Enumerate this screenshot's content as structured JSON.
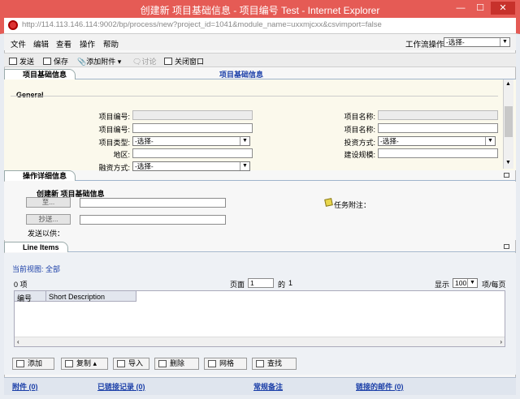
{
  "window": {
    "title": "创建新 项目基础信息 - 项目编号 Test - Internet Explorer",
    "min": "—",
    "max": "☐",
    "close": "✕"
  },
  "address": {
    "url": "http://114.113.146.114:9002/bp/process/new?project_id=1041&module_name=uxxmjcxx&csvimport=false"
  },
  "menu": {
    "items": [
      "文件",
      "编辑",
      "查看",
      "操作",
      "帮助"
    ],
    "workflow_label": "工作流操作",
    "workflow_value": "-选择-"
  },
  "toolbar": {
    "send": "发送",
    "save": "保存",
    "attach": "添加附件",
    "discuss": "讨论",
    "close": "关闭窗口"
  },
  "project": {
    "tab": "项目基础信息",
    "center_title": "项目基础信息",
    "group": "General",
    "labels": {
      "code_ro": "项目编号:",
      "code": "项目编号:",
      "type": "项目类型:",
      "region": "地区:",
      "finance": "融资方式:",
      "name_ro": "项目名称:",
      "name": "项目名称:",
      "invest": "投资方式:",
      "scale": "建设规模:"
    },
    "select_default": "-选择-"
  },
  "detail": {
    "tab": "操作详细信息",
    "title": "创建新 项目基础信息",
    "to_btn": "至...",
    "cc_btn": "抄送...",
    "send_for": "发送以供：",
    "task_note": "任务附注："
  },
  "line_items": {
    "tab": "Line Items",
    "view_label": "当前视图:",
    "view_value": "全部",
    "count": "0 项",
    "page_label": "页面",
    "page_value": "1",
    "of_label": "的",
    "of_value": "1",
    "show_label": "显示",
    "show_value": "100",
    "per_page": "项/每页",
    "col_no": "编号",
    "col_desc": "Short Description",
    "buttons": {
      "add": "添加",
      "copy": "复制",
      "import": "导入",
      "delete": "删除",
      "grid": "网格",
      "find": "查找"
    }
  },
  "footer": {
    "attach": "附件 (0)",
    "linked": "已链接记录 (0)",
    "notes": "常规备注",
    "mail": "链接的邮件 (0)"
  },
  "colors": {
    "titlebar": "#e55b55",
    "link": "#1b3fa8",
    "panel": "#fbf9ec"
  }
}
